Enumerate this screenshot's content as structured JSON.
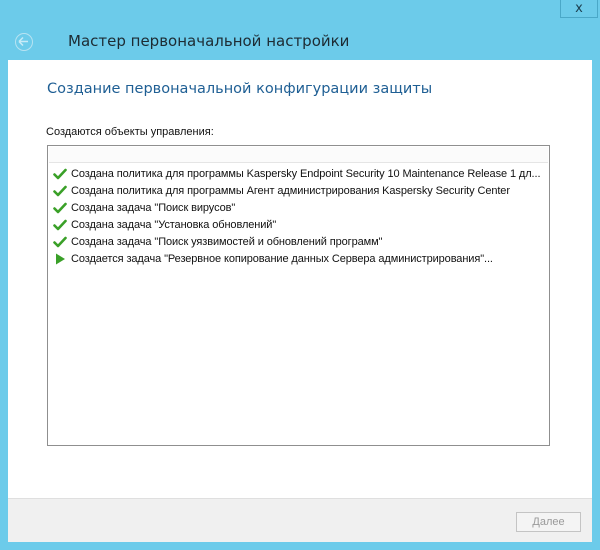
{
  "window": {
    "title": "Мастер первоначальной настройки",
    "close_label": "x",
    "accent_color": "#6ccbea"
  },
  "content": {
    "heading": "Создание первоначальной конфигурации защиты",
    "list_label": "Создаются объекты управления:",
    "items": [
      {
        "status": "done",
        "icon": "check-icon",
        "text": "Создана политика для программы Kaspersky Endpoint Security 10 Maintenance Release 1 дл..."
      },
      {
        "status": "done",
        "icon": "check-icon",
        "text": "Создана политика для программы Агент администрирования Kaspersky Security Center"
      },
      {
        "status": "done",
        "icon": "check-icon",
        "text": "Создана задача \"Поиск вирусов\""
      },
      {
        "status": "done",
        "icon": "check-icon",
        "text": "Создана задача \"Установка обновлений\""
      },
      {
        "status": "done",
        "icon": "check-icon",
        "text": "Создана задача \"Поиск уязвимостей и обновлений программ\""
      },
      {
        "status": "in-progress",
        "icon": "play-arrow-icon",
        "text": "Создается задача \"Резервное копирование данных Сервера администрирования\"..."
      }
    ]
  },
  "footer": {
    "next_label": "Далее"
  }
}
